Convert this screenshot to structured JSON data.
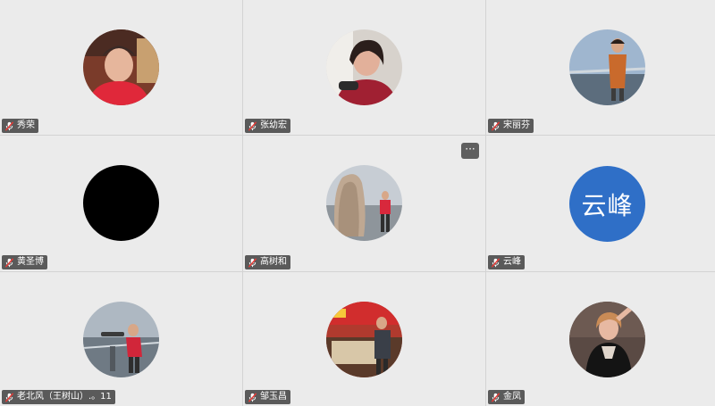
{
  "participants": [
    {
      "name": "秀荣",
      "avatar_type": "photo",
      "icon": "mic-muted-icon"
    },
    {
      "name": "张幼宏",
      "avatar_type": "photo",
      "icon": "mic-muted-icon"
    },
    {
      "name": "宋丽芬",
      "avatar_type": "photo",
      "icon": "mic-muted-icon"
    },
    {
      "name": "黄圣博",
      "avatar_type": "black",
      "icon": "mic-muted-icon"
    },
    {
      "name": "高树和",
      "avatar_type": "photo",
      "icon": "mic-muted-icon"
    },
    {
      "name": "云峰",
      "avatar_type": "text",
      "avatar_text": "云峰",
      "avatar_color": "#2f6fc7",
      "icon": "mic-muted-icon"
    },
    {
      "name": "老北风（王树山）.。11",
      "avatar_type": "photo",
      "icon": "mic-muted-icon"
    },
    {
      "name": "邹玉昌",
      "avatar_type": "photo",
      "icon": "mic-muted-icon"
    },
    {
      "name": "金凤",
      "avatar_type": "photo",
      "icon": "mic-muted-icon"
    }
  ],
  "more_button": {
    "label": "···"
  }
}
